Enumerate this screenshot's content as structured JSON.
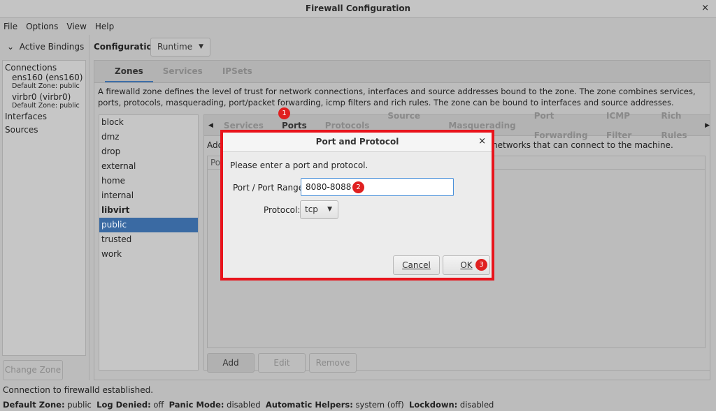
{
  "window": {
    "title": "Firewall Configuration",
    "close": "×"
  },
  "menu": [
    "File",
    "Options",
    "View",
    "Help"
  ],
  "left": {
    "bindings": "Active Bindings",
    "connections": "Connections",
    "items": [
      {
        "name": "ens160 (ens160)",
        "zone": "Default Zone: public"
      },
      {
        "name": "virbr0 (virbr0)",
        "zone": "Default Zone: public"
      }
    ],
    "interfaces": "Interfaces",
    "sources": "Sources",
    "change_zone": "Change Zone"
  },
  "config": {
    "label": "Configuration:",
    "value": "Runtime"
  },
  "tabs": [
    "Zones",
    "Services",
    "IPSets"
  ],
  "description": "A firewalld zone defines the level of trust for network connections, interfaces and source addresses bound to the zone. The zone combines services, ports, protocols, masquerading, port/packet forwarding, icmp filters and rich rules. The zone can be bound to interfaces and source addresses.",
  "zones": [
    "block",
    "dmz",
    "drop",
    "external",
    "home",
    "internal",
    "libvirt",
    "public",
    "trusted",
    "work"
  ],
  "selected_zone": "public",
  "zone_tabs": [
    "Services",
    "Ports",
    "Protocols",
    "Source Ports",
    "Masquerading",
    "Port Forwarding",
    "ICMP Filter",
    "Rich Rules"
  ],
  "ports_desc": {
    "left": "Add",
    "right": "networks that can connect to the machine."
  },
  "list_header": "Po",
  "buttons": {
    "add": "Add",
    "edit": "Edit",
    "remove": "Remove"
  },
  "status": {
    "message": "Connection to firewalld established.",
    "fields": [
      {
        "k": "Default Zone:",
        "v": "public"
      },
      {
        "k": "Log Denied:",
        "v": "off"
      },
      {
        "k": "Panic Mode:",
        "v": "disabled"
      },
      {
        "k": "Automatic Helpers:",
        "v": "system (off)"
      },
      {
        "k": "Lockdown:",
        "v": "disabled"
      }
    ]
  },
  "dialog": {
    "title": "Port and Protocol",
    "close": "×",
    "prompt": "Please enter a port and protocol.",
    "port_label": "Port / Port Range:",
    "port_value": "8080-8088",
    "protocol_label": "Protocol:",
    "protocol_value": "tcp",
    "cancel": "Cancel",
    "ok": "OK"
  },
  "badges": [
    "1",
    "2",
    "3"
  ],
  "colors": {
    "highlight": "#e8141c",
    "selection": "#3a6aa3"
  }
}
